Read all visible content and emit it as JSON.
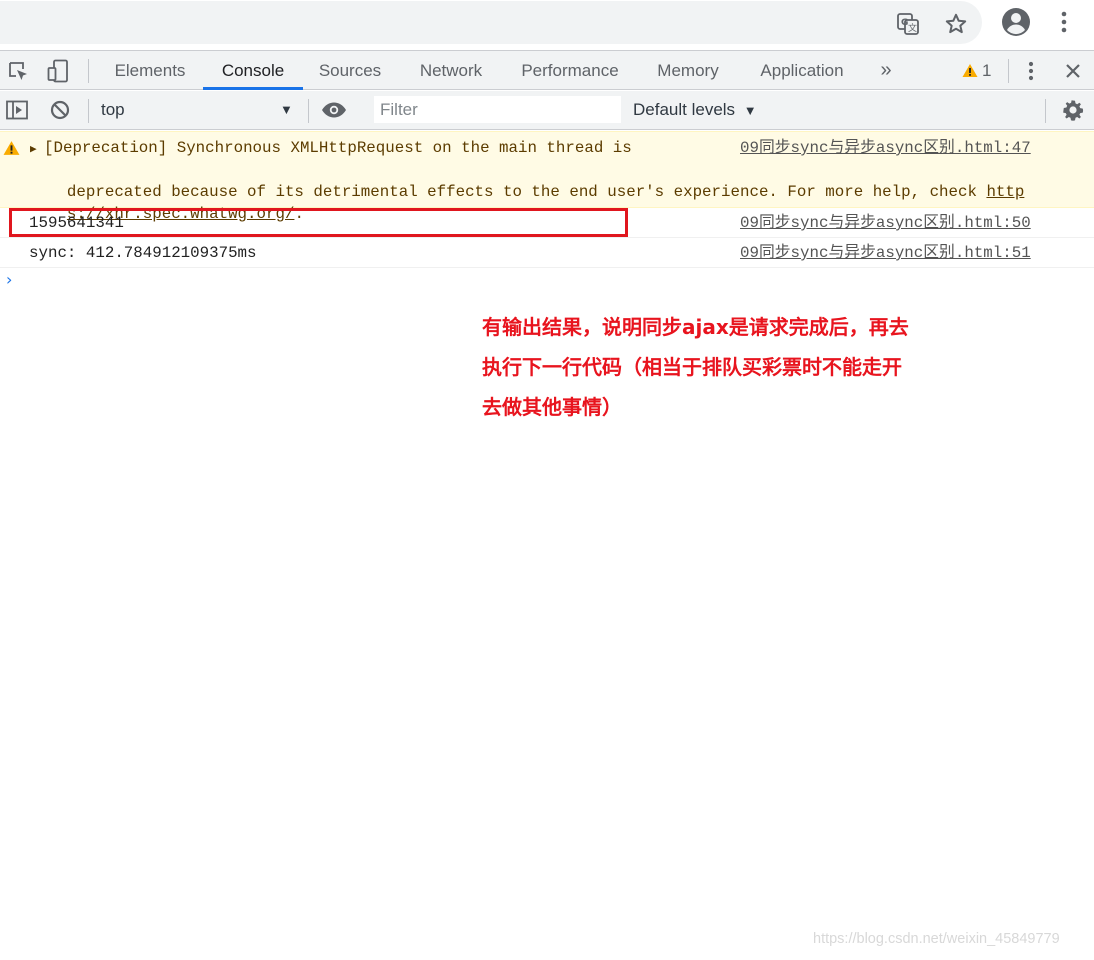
{
  "devtools": {
    "tabs": [
      "Elements",
      "Console",
      "Sources",
      "Network",
      "Performance",
      "Memory",
      "Application"
    ],
    "more_tabs": "»",
    "warning_count": "1"
  },
  "toolbar": {
    "context": "top",
    "filter_placeholder": "Filter",
    "levels": "Default levels"
  },
  "messages": [
    {
      "type": "warning",
      "lines": [
        "[Deprecation] Synchronous XMLHttpRequest on the main thread is",
        "deprecated because of its detrimental effects to the end user's experience. For more help, check http",
        "s://xhr.spec.whatwg.org/."
      ],
      "link_part1": "http",
      "link_part2": "s://xhr.spec.whatwg.org/",
      "source": "09同步sync与异步async区别.html:47"
    },
    {
      "type": "log",
      "text": "1595641341",
      "source": "09同步sync与异步async区别.html:50"
    },
    {
      "type": "log",
      "text": "sync: 412.784912109375ms",
      "source": "09同步sync与异步async区别.html:51"
    }
  ],
  "annotation": {
    "lines": [
      "有输出结果，说明同步ajax是请求完成后，再去",
      "执行下一行代码（相当于排队买彩票时不能走开",
      "去做其他事情）"
    ],
    "color": "#e8141e"
  },
  "watermark": "https://blog.csdn.net/weixin_45849779"
}
